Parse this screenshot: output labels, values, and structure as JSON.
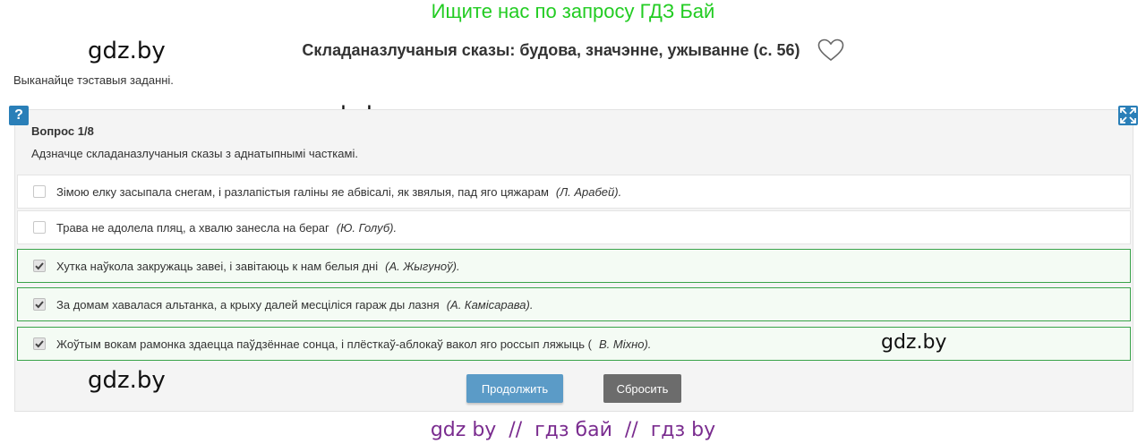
{
  "banner": "Ищите нас по запросу ГДЗ Бай",
  "watermark": "gdz.by",
  "page": {
    "title": "Складаназлучаныя сказы: будова, значэнне, ужыванне (с. 56)",
    "instruction": "Выканайце тэставыя заданні."
  },
  "icons": {
    "favorite": "heart-outline-icon",
    "help": "question-icon",
    "fullscreen": "expand-icon",
    "check": "checkmark-icon"
  },
  "quiz": {
    "help_label": "?",
    "question_number": "Вопрос 1/8",
    "question_text": "Адзначце складаназлучаныя сказы з аднатыпнымі часткамі.",
    "options": [
      {
        "text": "Зімою елку засыпала снегам, і разлапістыя галіны яе абвісалі, як звялыя, пад яго цяжарам",
        "author": "(Л. Арабей).",
        "checked": false
      },
      {
        "text": "Трава не адолела пляц, а хвалю занесла на бераг",
        "author": "(Ю. Голуб).",
        "checked": false
      },
      {
        "text": "Хутка наўкола закружаць завеі, і завітаюць к нам белыя дні",
        "author": "(А. Жыгуноў).",
        "checked": true
      },
      {
        "text": "За домам хавалася альтанка, а крыху далей месціліся гараж ды лазня",
        "author": "(А. Камісарава).",
        "checked": true
      },
      {
        "text": "Жоўтым вокам рамонка здаецца паўдзённае сонца, і плёсткаў-аблокаў вакол яго россып ляжыць (",
        "author": "В. Міхно).",
        "checked": true
      }
    ],
    "continue_label": "Продолжить",
    "reset_label": "Сбросить"
  },
  "footer": "gdz by  //  гдз бай  //  гдз by",
  "colors": {
    "banner": "#22cc22",
    "accent": "#2a7fb8",
    "selected_border": "#3aa34a",
    "continue": "#5b9bc7",
    "reset": "#6c6c6c",
    "footer": "#7a2c8f"
  }
}
